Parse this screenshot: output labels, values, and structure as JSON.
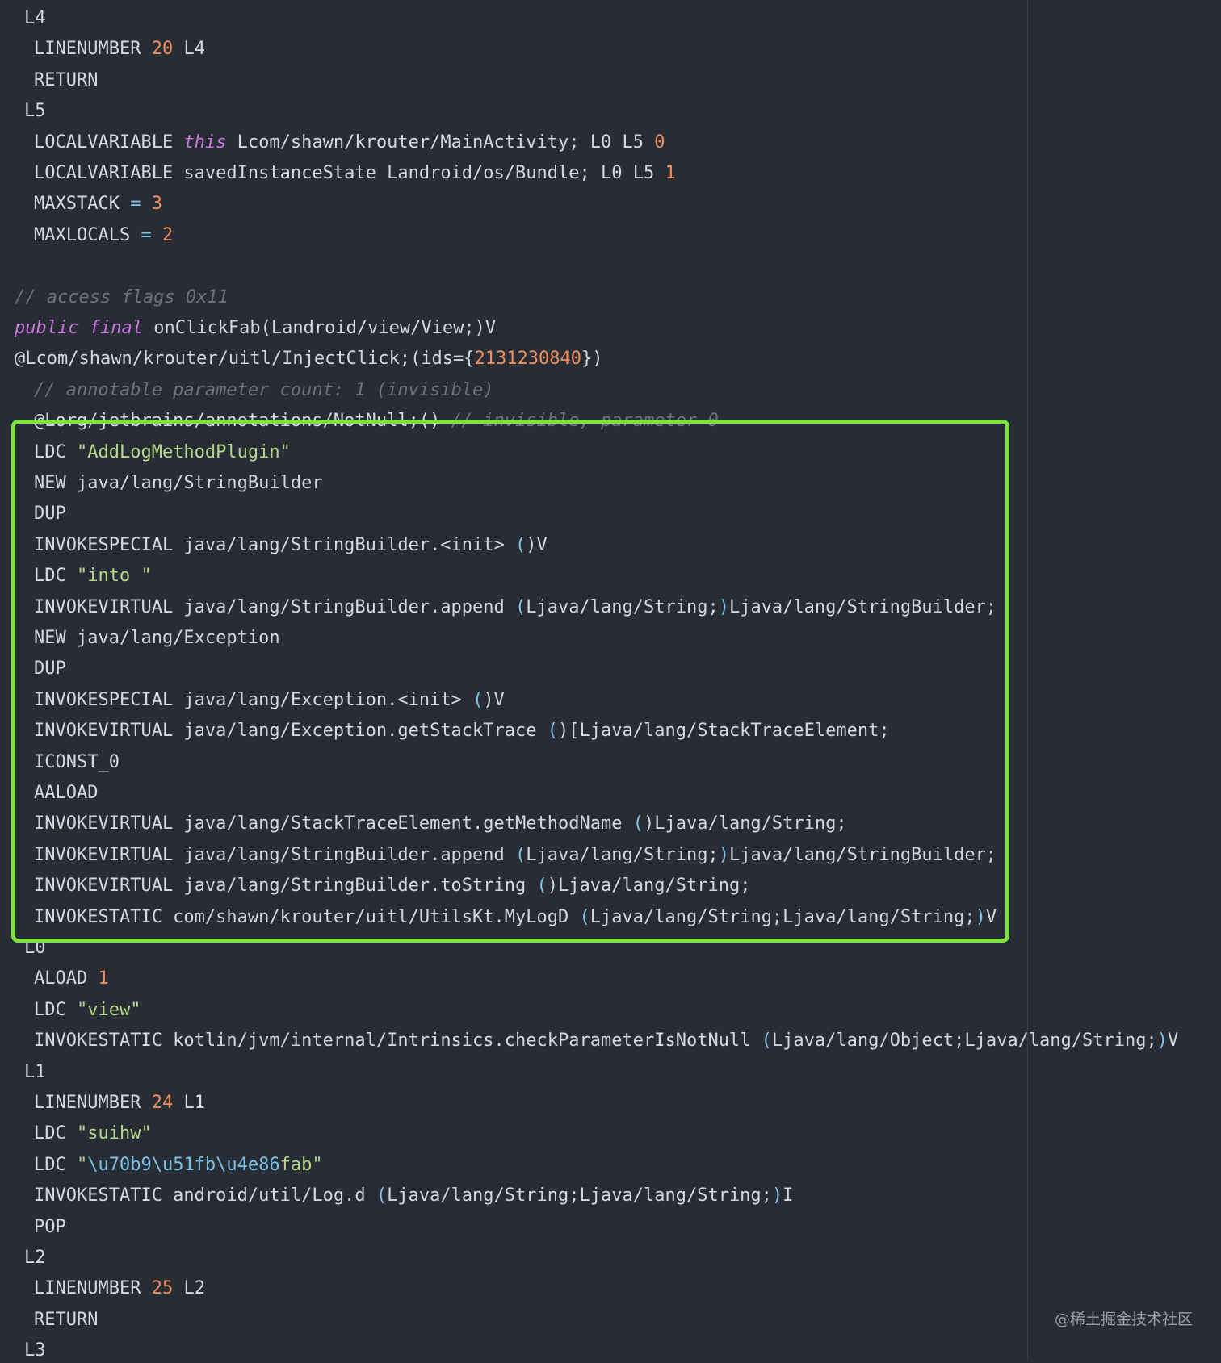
{
  "editor": {
    "lines": [
      {
        "indent": 1,
        "tokens": [
          {
            "t": "L4",
            "c": "plain"
          }
        ]
      },
      {
        "indent": 2,
        "tokens": [
          {
            "t": "LINENUMBER ",
            "c": "plain"
          },
          {
            "t": "20",
            "c": "num"
          },
          {
            "t": " L4",
            "c": "plain"
          }
        ]
      },
      {
        "indent": 2,
        "tokens": [
          {
            "t": "RETURN",
            "c": "plain"
          }
        ]
      },
      {
        "indent": 1,
        "tokens": [
          {
            "t": "L5",
            "c": "plain"
          }
        ]
      },
      {
        "indent": 2,
        "tokens": [
          {
            "t": "LOCALVARIABLE ",
            "c": "plain"
          },
          {
            "t": "this",
            "c": "kw"
          },
          {
            "t": " Lcom/shawn/krouter/MainActivity; L0 L5 ",
            "c": "plain"
          },
          {
            "t": "0",
            "c": "num"
          }
        ]
      },
      {
        "indent": 2,
        "tokens": [
          {
            "t": "LOCALVARIABLE savedInstanceState Landroid/os/Bundle; L0 L5 ",
            "c": "plain"
          },
          {
            "t": "1",
            "c": "num"
          }
        ]
      },
      {
        "indent": 2,
        "tokens": [
          {
            "t": "MAXSTACK ",
            "c": "plain"
          },
          {
            "t": "=",
            "c": "op"
          },
          {
            "t": " ",
            "c": "plain"
          },
          {
            "t": "3",
            "c": "num"
          }
        ]
      },
      {
        "indent": 2,
        "tokens": [
          {
            "t": "MAXLOCALS ",
            "c": "plain"
          },
          {
            "t": "=",
            "c": "op"
          },
          {
            "t": " ",
            "c": "plain"
          },
          {
            "t": "2",
            "c": "num"
          }
        ]
      },
      {
        "indent": 0,
        "tokens": [
          {
            "t": "",
            "c": "plain"
          }
        ]
      },
      {
        "indent": 0,
        "tokens": [
          {
            "t": "// access flags 0x11",
            "c": "cmt"
          }
        ]
      },
      {
        "indent": 0,
        "tokens": [
          {
            "t": "public",
            "c": "kw"
          },
          {
            "t": " ",
            "c": "plain"
          },
          {
            "t": "final",
            "c": "kw"
          },
          {
            "t": " onClickFab(Landroid/view/View;)V",
            "c": "plain"
          }
        ]
      },
      {
        "indent": 0,
        "tokens": [
          {
            "t": "@Lcom/shawn/krouter/uitl/InjectClick;(ids={",
            "c": "plain"
          },
          {
            "t": "2131230840",
            "c": "num"
          },
          {
            "t": "})",
            "c": "plain"
          }
        ]
      },
      {
        "indent": 2,
        "tokens": [
          {
            "t": "// annotable parameter count: 1 (invisible)",
            "c": "cmt"
          }
        ]
      },
      {
        "indent": 2,
        "tokens": [
          {
            "t": "@Lorg/jetbrains/annotations/NotNull;() ",
            "c": "plain"
          },
          {
            "t": "// invisible, parameter 0",
            "c": "cmt"
          }
        ]
      },
      {
        "indent": 2,
        "tokens": [
          {
            "t": "LDC ",
            "c": "plain"
          },
          {
            "t": "\"AddLogMethodPlugin\"",
            "c": "str"
          }
        ]
      },
      {
        "indent": 2,
        "tokens": [
          {
            "t": "NEW java/lang/StringBuilder",
            "c": "plain"
          }
        ]
      },
      {
        "indent": 2,
        "tokens": [
          {
            "t": "DUP",
            "c": "plain"
          }
        ]
      },
      {
        "indent": 2,
        "tokens": [
          {
            "t": "INVOKESPECIAL java/lang/StringBuilder.<init> ",
            "c": "plain"
          },
          {
            "t": "(",
            "c": "op"
          },
          {
            "t": ")V",
            "c": "plain"
          }
        ]
      },
      {
        "indent": 2,
        "tokens": [
          {
            "t": "LDC ",
            "c": "plain"
          },
          {
            "t": "\"into \"",
            "c": "str"
          }
        ]
      },
      {
        "indent": 2,
        "tokens": [
          {
            "t": "INVOKEVIRTUAL java/lang/StringBuilder.append ",
            "c": "plain"
          },
          {
            "t": "(",
            "c": "op"
          },
          {
            "t": "Ljava/lang/String;",
            "c": "plain"
          },
          {
            "t": ")",
            "c": "op"
          },
          {
            "t": "Ljava/lang/StringBuilder;",
            "c": "plain"
          }
        ]
      },
      {
        "indent": 2,
        "tokens": [
          {
            "t": "NEW java/lang/Exception",
            "c": "plain"
          }
        ]
      },
      {
        "indent": 2,
        "tokens": [
          {
            "t": "DUP",
            "c": "plain"
          }
        ]
      },
      {
        "indent": 2,
        "tokens": [
          {
            "t": "INVOKESPECIAL java/lang/Exception.<init> ",
            "c": "plain"
          },
          {
            "t": "(",
            "c": "op"
          },
          {
            "t": ")V",
            "c": "plain"
          }
        ]
      },
      {
        "indent": 2,
        "tokens": [
          {
            "t": "INVOKEVIRTUAL java/lang/Exception.getStackTrace ",
            "c": "plain"
          },
          {
            "t": "(",
            "c": "op"
          },
          {
            "t": ")[Ljava/lang/StackTraceElement;",
            "c": "plain"
          }
        ]
      },
      {
        "indent": 2,
        "tokens": [
          {
            "t": "ICONST_0",
            "c": "plain"
          }
        ]
      },
      {
        "indent": 2,
        "tokens": [
          {
            "t": "AALOAD",
            "c": "plain"
          }
        ]
      },
      {
        "indent": 2,
        "tokens": [
          {
            "t": "INVOKEVIRTUAL java/lang/StackTraceElement.getMethodName ",
            "c": "plain"
          },
          {
            "t": "(",
            "c": "op"
          },
          {
            "t": ")Ljava/lang/String;",
            "c": "plain"
          }
        ]
      },
      {
        "indent": 2,
        "tokens": [
          {
            "t": "INVOKEVIRTUAL java/lang/StringBuilder.append ",
            "c": "plain"
          },
          {
            "t": "(",
            "c": "op"
          },
          {
            "t": "Ljava/lang/String;",
            "c": "plain"
          },
          {
            "t": ")",
            "c": "op"
          },
          {
            "t": "Ljava/lang/StringBuilder;",
            "c": "plain"
          }
        ]
      },
      {
        "indent": 2,
        "tokens": [
          {
            "t": "INVOKEVIRTUAL java/lang/StringBuilder.toString ",
            "c": "plain"
          },
          {
            "t": "(",
            "c": "op"
          },
          {
            "t": ")Ljava/lang/String;",
            "c": "plain"
          }
        ]
      },
      {
        "indent": 2,
        "tokens": [
          {
            "t": "INVOKESTATIC com/shawn/krouter/uitl/UtilsKt.MyLogD ",
            "c": "plain"
          },
          {
            "t": "(",
            "c": "op"
          },
          {
            "t": "Ljava/lang/String;Ljava/lang/String;",
            "c": "plain"
          },
          {
            "t": ")",
            "c": "op"
          },
          {
            "t": "V",
            "c": "plain"
          }
        ]
      },
      {
        "indent": 1,
        "tokens": [
          {
            "t": "L0",
            "c": "plain"
          }
        ]
      },
      {
        "indent": 2,
        "tokens": [
          {
            "t": "ALOAD ",
            "c": "plain"
          },
          {
            "t": "1",
            "c": "num"
          }
        ]
      },
      {
        "indent": 2,
        "tokens": [
          {
            "t": "LDC ",
            "c": "plain"
          },
          {
            "t": "\"view\"",
            "c": "str"
          }
        ]
      },
      {
        "indent": 2,
        "tokens": [
          {
            "t": "INVOKESTATIC kotlin/jvm/internal/Intrinsics.checkParameterIsNotNull ",
            "c": "plain"
          },
          {
            "t": "(",
            "c": "op"
          },
          {
            "t": "Ljava/lang/Object;Ljava/lang/String;",
            "c": "plain"
          },
          {
            "t": ")",
            "c": "op"
          },
          {
            "t": "V",
            "c": "plain"
          }
        ]
      },
      {
        "indent": 1,
        "tokens": [
          {
            "t": "L1",
            "c": "plain"
          }
        ]
      },
      {
        "indent": 2,
        "tokens": [
          {
            "t": "LINENUMBER ",
            "c": "plain"
          },
          {
            "t": "24",
            "c": "num"
          },
          {
            "t": " L1",
            "c": "plain"
          }
        ]
      },
      {
        "indent": 2,
        "tokens": [
          {
            "t": "LDC ",
            "c": "plain"
          },
          {
            "t": "\"suihw\"",
            "c": "str"
          }
        ]
      },
      {
        "indent": 2,
        "tokens": [
          {
            "t": "LDC ",
            "c": "plain"
          },
          {
            "t": "\"",
            "c": "str"
          },
          {
            "t": "\\u70b9\\u51fb\\u4e86",
            "c": "esc"
          },
          {
            "t": "fab\"",
            "c": "str"
          }
        ]
      },
      {
        "indent": 2,
        "tokens": [
          {
            "t": "INVOKESTATIC android/util/Log.d ",
            "c": "plain"
          },
          {
            "t": "(",
            "c": "op"
          },
          {
            "t": "Ljava/lang/String;Ljava/lang/String;",
            "c": "plain"
          },
          {
            "t": ")",
            "c": "op"
          },
          {
            "t": "I",
            "c": "plain"
          }
        ]
      },
      {
        "indent": 2,
        "tokens": [
          {
            "t": "POP",
            "c": "plain"
          }
        ]
      },
      {
        "indent": 1,
        "tokens": [
          {
            "t": "L2",
            "c": "plain"
          }
        ]
      },
      {
        "indent": 2,
        "tokens": [
          {
            "t": "LINENUMBER ",
            "c": "plain"
          },
          {
            "t": "25",
            "c": "num"
          },
          {
            "t": " L2",
            "c": "plain"
          }
        ]
      },
      {
        "indent": 2,
        "tokens": [
          {
            "t": "RETURN",
            "c": "plain"
          }
        ]
      },
      {
        "indent": 1,
        "tokens": [
          {
            "t": "L3",
            "c": "plain"
          }
        ]
      }
    ]
  },
  "highlight": {
    "color": "#7fe044"
  },
  "watermark": {
    "text": "@稀土掘金技术社区"
  },
  "colors": {
    "background": "#282c34",
    "text": "#d3d7de",
    "number": "#f08d5c",
    "string": "#b5d98a",
    "keyword": "#c678dd",
    "comment": "#6b7280"
  }
}
